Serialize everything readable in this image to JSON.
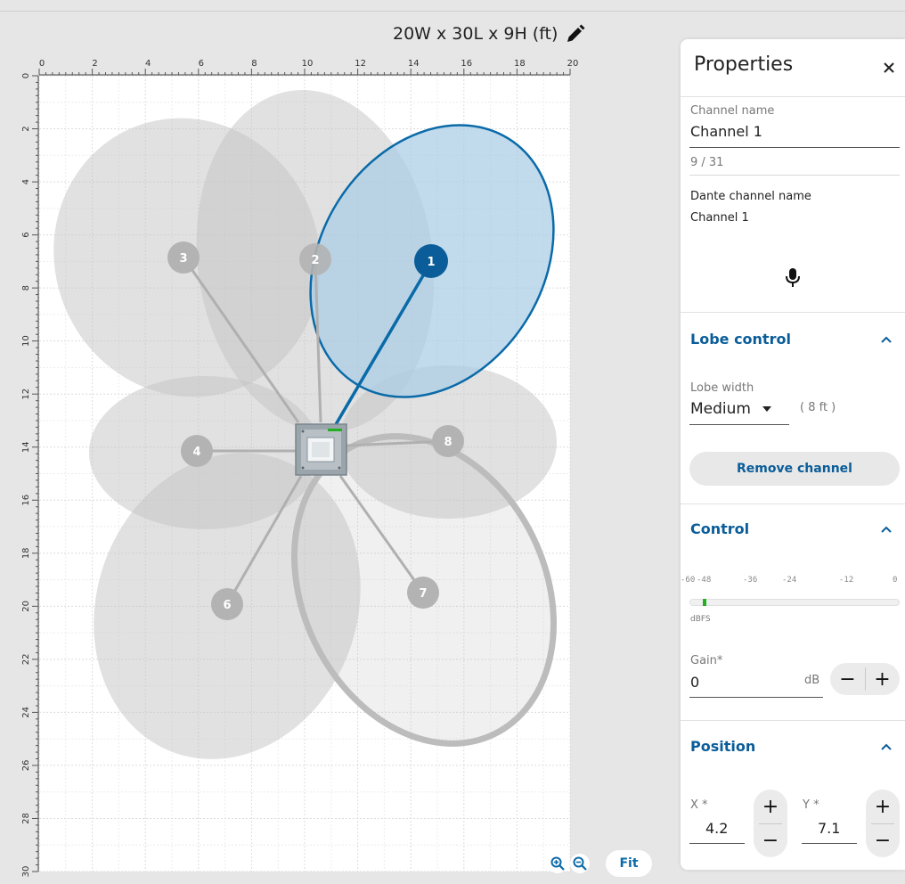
{
  "room": {
    "title": "20W x 30L x 9H (ft)"
  },
  "rulers": {
    "x_labels": [
      "0",
      "2",
      "4",
      "6",
      "8",
      "10",
      "12",
      "14",
      "16",
      "18",
      "20"
    ],
    "y_labels": [
      "0",
      "2",
      "4",
      "6",
      "8",
      "10",
      "12",
      "14",
      "16",
      "18",
      "20",
      "22",
      "24",
      "26",
      "28",
      "30"
    ]
  },
  "device": {
    "name": "microphone-array"
  },
  "lobes": [
    {
      "id": "1",
      "selected": true
    },
    {
      "id": "2",
      "selected": false
    },
    {
      "id": "3",
      "selected": false
    },
    {
      "id": "4",
      "selected": false
    },
    {
      "id": "6",
      "selected": false
    },
    {
      "id": "7",
      "selected": false
    },
    {
      "id": "8",
      "selected": false
    }
  ],
  "canvas_controls": {
    "zoom_in_icon": "zoom-in-icon",
    "zoom_out_icon": "zoom-out-icon",
    "fit_label": "Fit"
  },
  "panel": {
    "title": "Properties",
    "close_icon": "close-icon",
    "channel_name_label": "Channel name",
    "channel_name_value": "Channel 1",
    "char_count": "9 / 31",
    "dante_label": "Dante channel name",
    "dante_value": "Channel 1",
    "mic_icon": "microphone-icon",
    "lobe_control": {
      "title": "Lobe control",
      "lobe_width_label": "Lobe width",
      "lobe_width_value": "Medium",
      "lobe_width_hint": "( 8 ft )",
      "remove_label": "Remove channel"
    },
    "control": {
      "title": "Control",
      "meter_ticks": [
        "-60",
        "-48",
        "-36",
        "-24",
        "-12",
        "0"
      ],
      "meter_unit": "dBFS",
      "meter_level": -56,
      "gain_label": "Gain*",
      "gain_value": "0",
      "gain_unit": "dB",
      "minus": "−",
      "plus": "+"
    },
    "position": {
      "title": "Position",
      "x_label": "X *",
      "x_value": "4.2",
      "y_label": "Y *",
      "y_value": "7.1",
      "plus": "+",
      "minus": "−"
    }
  },
  "colors": {
    "accent": "#0a5d99",
    "lobe_selected_fill": "#a9cde6",
    "lobe_selected_stroke": "#0a6aa8",
    "lobe_fill": "#bfbfbf",
    "meter_green": "#22b022"
  }
}
